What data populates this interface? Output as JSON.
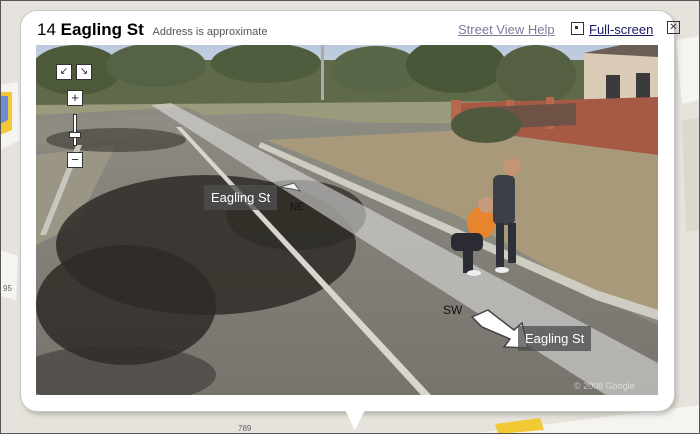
{
  "info_window": {
    "house_number": "14",
    "street": "Eagling St",
    "address_note": "Address is approximate",
    "help_link": "Street View Help",
    "fullscreen_label": "Full-screen",
    "close_glyph": "✕"
  },
  "panorama": {
    "street_label_ne": "Eagling St",
    "heading_ne": "NE",
    "street_label_sw": "Eagling St",
    "heading_sw": "SW",
    "copyright": "© 2008 Google",
    "controls": {
      "pan_left_glyph": "↙",
      "pan_right_glyph": "↘",
      "zoom_in_glyph": "+",
      "zoom_out_glyph": "−"
    }
  },
  "map": {
    "label_left": "95",
    "label_bottom": "789"
  },
  "colors": {
    "map_road_yellow": "#f2c935",
    "map_road_blue": "#6a8fd8",
    "link_dark": "#1a1a66",
    "link_muted": "#7a7a9a"
  }
}
